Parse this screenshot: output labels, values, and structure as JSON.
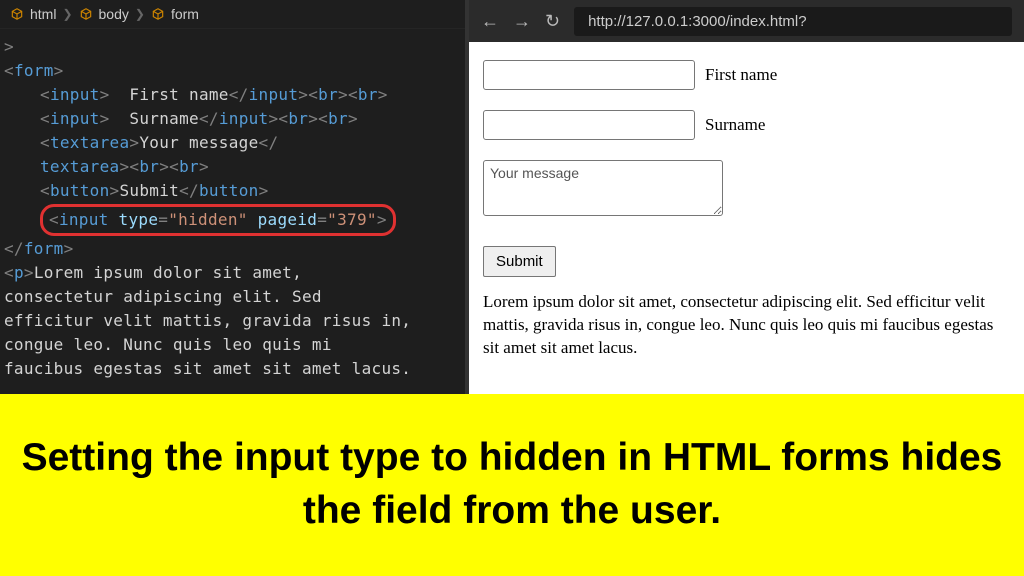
{
  "breadcrumbs": {
    "item1": "html",
    "item2": "body",
    "item3": "form"
  },
  "code": {
    "line1_close": ">",
    "form_open": "form",
    "input_tag": "input",
    "firstname_txt": "  First name",
    "surname_txt": "  Surname",
    "br_tag": "br",
    "textarea_tag": "textarea",
    "textarea_txt": "Your message",
    "button_tag": "button",
    "button_txt": "Submit",
    "hidden_type_attr": "type",
    "hidden_type_val": "\"hidden\"",
    "hidden_pageid_attr": "pageid",
    "hidden_pageid_val": "\"379\"",
    "form_close": "form",
    "p_tag": "p",
    "p_text1": "Lorem ipsum dolor sit amet,",
    "p_text2": "consectetur adipiscing elit. Sed",
    "p_text3": "efficitur velit mattis, gravida risus in,",
    "p_text4": "congue leo. Nunc quis leo quis mi",
    "p_text5": "faucibus egestas sit amet sit amet lacus."
  },
  "browser": {
    "back": "←",
    "forward": "→",
    "reload": "↻",
    "url": "http://127.0.0.1:3000/index.html?"
  },
  "page": {
    "firstname_label": "First name",
    "surname_label": "Surname",
    "textarea_value": "Your message",
    "submit_label": "Submit",
    "lorem": "Lorem ipsum dolor sit amet, consectetur adipiscing elit. Sed efficitur velit mattis, gravida risus in, congue leo. Nunc quis leo quis mi faucibus egestas sit amet sit amet lacus."
  },
  "banner": {
    "text": "Setting the input type to hidden in HTML forms hides the field from the user."
  }
}
